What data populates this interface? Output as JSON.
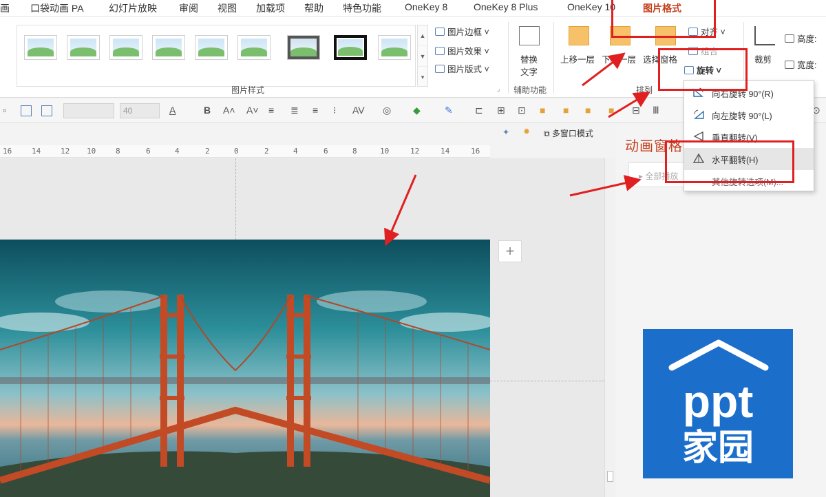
{
  "tabs": [
    {
      "label": "画"
    },
    {
      "label": "口袋动画 PA"
    },
    {
      "label": "幻灯片放映"
    },
    {
      "label": "审阅"
    },
    {
      "label": "视图"
    },
    {
      "label": "加载项"
    },
    {
      "label": "帮助"
    },
    {
      "label": "特色功能"
    },
    {
      "label": "OneKey 8"
    },
    {
      "label": "OneKey 8 Plus"
    },
    {
      "label": "OneKey 10"
    },
    {
      "label": "图片格式",
      "active": true
    }
  ],
  "ribbon": {
    "picture_styles": {
      "border_label": "图片边框",
      "effects_label": "图片效果",
      "layout_label": "图片版式",
      "group_label": "图片样式"
    },
    "accessibility": {
      "alt_text_label_1": "替换",
      "alt_text_label_2": "文字",
      "group_label": "辅助功能"
    },
    "arrange": {
      "bring_forward_label": "上移一层",
      "send_backward_label": "下移一层",
      "selection_pane_label": "选择窗格",
      "align_label": "对齐",
      "group_objects_label": "组合",
      "rotate_label": "旋转",
      "group_label": "排列"
    },
    "size": {
      "crop_label": "裁剪",
      "height_label": "高度:",
      "width_label": "宽度:"
    }
  },
  "format_toolbar": {
    "font_box_value": "",
    "font_size_value": "40"
  },
  "pane_tools": {
    "multi_window_label": "多窗口模式"
  },
  "ruler": {
    "ticks": [
      "16",
      "14",
      "12",
      "10",
      "8",
      "6",
      "4",
      "2",
      "0",
      "2",
      "4",
      "6",
      "8",
      "10",
      "12",
      "14",
      "16"
    ]
  },
  "animation_pane": {
    "title": "动画窗格",
    "play_all_label": "全部播放"
  },
  "rotate_menu": {
    "items": [
      {
        "label": "向右旋转 90°(R)",
        "icon": "rotate-right-icon"
      },
      {
        "label": "向左旋转 90°(L)",
        "icon": "rotate-left-icon"
      },
      {
        "label": "垂直翻转(V)",
        "icon": "flip-vertical-icon"
      },
      {
        "label": "水平翻转(H)",
        "icon": "flip-horizontal-icon",
        "highlighted": true
      },
      {
        "label": "其他旋转选项(M)...",
        "icon": ""
      }
    ]
  },
  "logo": {
    "line1": "ppt",
    "line2": "家园"
  },
  "colors": {
    "accent_red": "#e02020",
    "tab_active": "#c43e1c",
    "logo_blue": "#1c6ecb",
    "ribbon_bg": "#ffffff"
  }
}
